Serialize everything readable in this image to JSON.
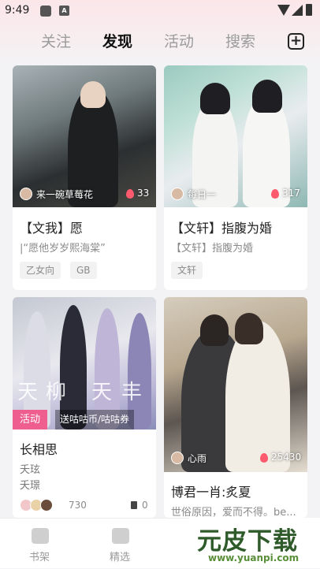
{
  "status_bar": {
    "time": "9:49",
    "notif_icon_letter": "A"
  },
  "tabs": [
    {
      "label": "关注",
      "active": false
    },
    {
      "label": "发现",
      "active": true
    },
    {
      "label": "活动",
      "active": false
    },
    {
      "label": "搜索",
      "active": false
    }
  ],
  "add_icon": "plus-square-icon",
  "cards": [
    {
      "title": "【文我】愿",
      "subtitle": "|“愿他岁岁熙海棠”",
      "author": "来一碗草莓花",
      "likes": "33",
      "tags": [
        "乙女向",
        "GB"
      ]
    },
    {
      "title": "【文轩】指腹为婚",
      "subtitle": "【文轩】指腹为婚",
      "author": "每日一",
      "likes": "317",
      "tags": [
        "文轩"
      ]
    },
    {
      "title": "长相思",
      "activity_badge": "活动",
      "activity_text": "送咕咕币/咕咕券",
      "image_text_1": "天",
      "image_text_2": "柳",
      "image_text_3": "天",
      "image_text_4": "丰",
      "lines": [
        "夭玹",
        "夭璟"
      ],
      "count": "730",
      "comments": "0"
    },
    {
      "title": "博君一肖:炙夏",
      "subtitle": "世俗原因，爱而不得。be...",
      "author": "心雨",
      "likes": "25430"
    }
  ],
  "bottom_nav": [
    {
      "label": "书架",
      "icon": "bookshelf-icon"
    },
    {
      "label": "精选",
      "icon": "star-icon"
    }
  ],
  "watermark": {
    "title": "元皮下载",
    "site": "www.yuanpi.com"
  },
  "colors": {
    "accent": "#ee5e8f",
    "flame": "#ff5a6e"
  }
}
